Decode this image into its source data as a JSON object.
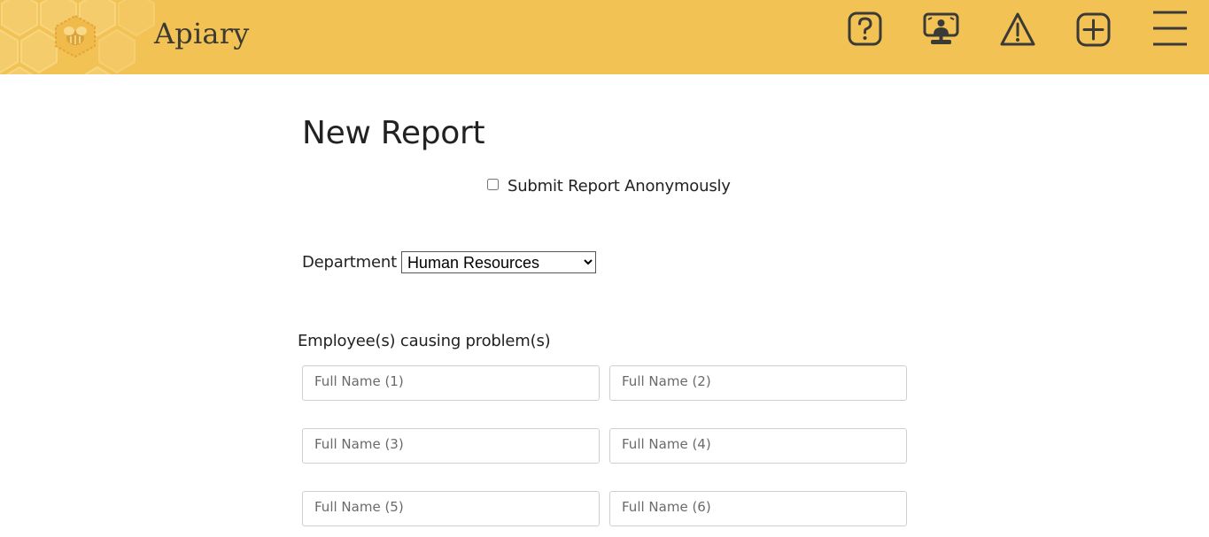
{
  "header": {
    "app_title": "Apiary",
    "background_color": "#f2c255",
    "nav_icons": [
      {
        "name": "help-icon"
      },
      {
        "name": "presentation-icon"
      },
      {
        "name": "warning-icon"
      },
      {
        "name": "add-icon"
      },
      {
        "name": "menu-icon"
      }
    ]
  },
  "form": {
    "title": "New Report",
    "anonymous": {
      "label": "Submit Report Anonymously",
      "checked": false
    },
    "department": {
      "label": "Department",
      "selected": "Human Resources"
    },
    "employees_section": {
      "label": "Employee(s) causing problem(s)",
      "fields": [
        {
          "placeholder": "Full Name (1)",
          "value": ""
        },
        {
          "placeholder": "Full Name (2)",
          "value": ""
        },
        {
          "placeholder": "Full Name (3)",
          "value": ""
        },
        {
          "placeholder": "Full Name (4)",
          "value": ""
        },
        {
          "placeholder": "Full Name (5)",
          "value": ""
        },
        {
          "placeholder": "Full Name (6)",
          "value": ""
        }
      ]
    }
  }
}
